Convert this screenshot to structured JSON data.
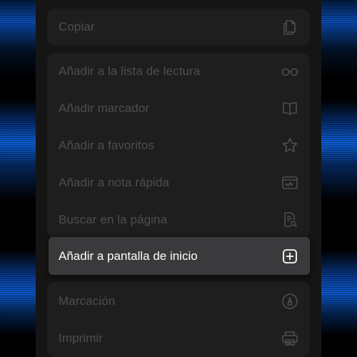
{
  "menu": {
    "group1": [
      {
        "label": "Copiar",
        "icon": "copy-icon"
      }
    ],
    "group2": [
      {
        "label": "Añadir a la lista de lectura",
        "icon": "reading-list-glasses-icon"
      },
      {
        "label": "Añadir marcador",
        "icon": "bookmark-book-icon"
      },
      {
        "label": "Añadir a favoritos",
        "icon": "star-icon"
      },
      {
        "label": "Añadir a nota rápida",
        "icon": "quick-note-icon"
      },
      {
        "label": "Buscar en la página",
        "icon": "find-in-page-icon"
      }
    ],
    "selected": {
      "label": "Añadir a pantalla de inicio",
      "icon": "add-square-icon"
    },
    "group3": [
      {
        "label": "Marcación",
        "icon": "markup-pen-icon"
      },
      {
        "label": "Imprimir",
        "icon": "printer-icon"
      }
    ]
  },
  "colors": {
    "sheet_background": "#151516",
    "group_background": "#1e1e1f",
    "dimmed_text": "#4e4e52",
    "highlight_background": "#3a3a3c",
    "highlight_text": "#ffffff",
    "wallpaper_accent": "#0d5fd6"
  }
}
